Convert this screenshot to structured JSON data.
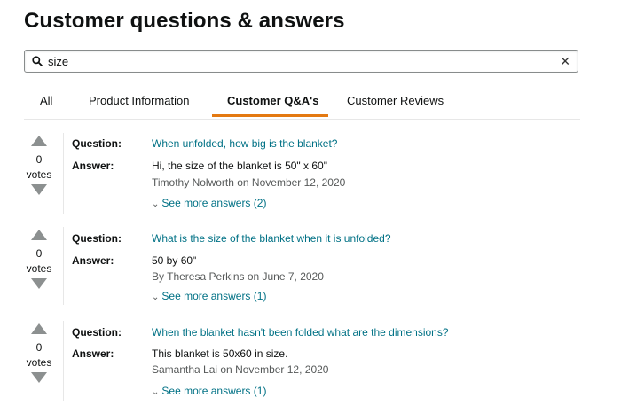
{
  "page": {
    "title": "Customer questions & answers"
  },
  "search": {
    "value": "size",
    "placeholder": ""
  },
  "tabs": [
    {
      "label": "All",
      "active": false
    },
    {
      "label": "Product Information",
      "active": false
    },
    {
      "label": "Customer Q&A's",
      "active": true
    },
    {
      "label": "Customer Reviews",
      "active": false
    }
  ],
  "labels": {
    "question": "Question:",
    "answer": "Answer:",
    "votes": "votes"
  },
  "qa": [
    {
      "votes": "0",
      "question": "When unfolded, how big is the blanket?",
      "answer": "Hi, the size of the blanket is 50\" x 60\"",
      "author": "Timothy Nolworth on November 12, 2020",
      "see_more": "See more answers (2)"
    },
    {
      "votes": "0",
      "question": "What is the size of the blanket when it is unfolded?",
      "answer": "50 by 60\"",
      "author": "By Theresa Perkins on June 7, 2020",
      "see_more": "See more answers (1)"
    },
    {
      "votes": "0",
      "question": "When the blanket hasn't been folded what are the dimensions?",
      "answer": "This blanket is 50x60 in size.",
      "author": "Samantha Lai on November 12, 2020",
      "see_more": "See more answers (1)"
    }
  ],
  "colors": {
    "accent": "#e47911",
    "link": "#007185",
    "muted": "#565959",
    "arrow": "#8c9090"
  }
}
